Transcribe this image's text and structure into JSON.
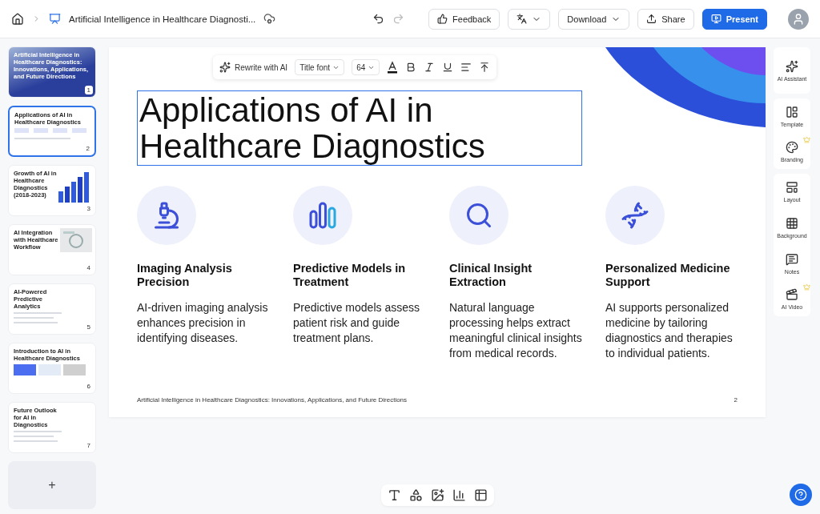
{
  "topbar": {
    "document_title": "Artificial Intelligence in Healthcare Diagnosti...",
    "buttons": [
      {
        "kind": "feedback",
        "label": "Feedback"
      },
      {
        "kind": "translate"
      },
      {
        "kind": "download",
        "label": "Download"
      },
      {
        "kind": "share",
        "label": "Share"
      },
      {
        "kind": "present",
        "label": "Present"
      }
    ]
  },
  "thumbnails": [
    {
      "number": "1",
      "title": "Artificial Intelligence in Healthcare Diagnostics: Innovations, Applications, and Future Directions",
      "kind": "cover",
      "selected": false
    },
    {
      "number": "2",
      "title": "Applications of AI in Healthcare Diagnostics",
      "kind": "cards",
      "selected": true
    },
    {
      "number": "3",
      "title": "Growth of AI in Healthcare Diagnostics (2018-2023)",
      "kind": "chart",
      "selected": false
    },
    {
      "number": "4",
      "title": "AI Integration with Healthcare Workflow",
      "selected": false
    },
    {
      "number": "5",
      "title": "AI-Powered Predictive Analytics",
      "kind": "list",
      "selected": false
    },
    {
      "number": "6",
      "title": "Introduction to AI in Healthcare Diagnostics",
      "kind": "grid",
      "selected": false
    },
    {
      "number": "7",
      "title": "Future Outlook for AI in Diagnostics",
      "kind": "list",
      "selected": false
    }
  ],
  "format_toolbar": {
    "rewrite": "Rewrite with AI",
    "font": "Title font",
    "size": "64"
  },
  "slide": {
    "title": "Applications of AI in Healthcare Diagnostics",
    "cards": [
      {
        "heading": "Imaging Analysis Precision",
        "body": "AI-driven imaging analysis enhances precision in identifying diseases."
      },
      {
        "heading": "Predictive Models in Treatment",
        "body": "Predictive models assess patient risk and guide treatment plans."
      },
      {
        "heading": "Clinical Insight Extraction",
        "body": "Natural language processing helps extract meaningful clinical insights from medical records."
      },
      {
        "heading": "Personalized Medicine Support",
        "body": "AI supports personalized medicine by tailoring diagnostics and therapies to individual patients."
      }
    ],
    "footer": "Artificial Intelligence in Healthcare Diagnostics: Innovations, Applications, and Future Directions",
    "page_number": "2"
  },
  "side_tools": [
    [
      {
        "kind": "assistant",
        "label": "AI Assistant",
        "premium": false
      }
    ],
    [
      {
        "kind": "template",
        "label": "Template",
        "premium": false
      },
      {
        "kind": "branding",
        "label": "Branding",
        "premium": true
      }
    ],
    [
      {
        "kind": "layout",
        "label": "Layout",
        "premium": false
      },
      {
        "kind": "background",
        "label": "Background",
        "premium": false
      },
      {
        "kind": "notes",
        "label": "Notes",
        "premium": false
      },
      {
        "kind": "video",
        "label": "AI Video",
        "premium": true
      }
    ]
  ],
  "add_slide": "+"
}
